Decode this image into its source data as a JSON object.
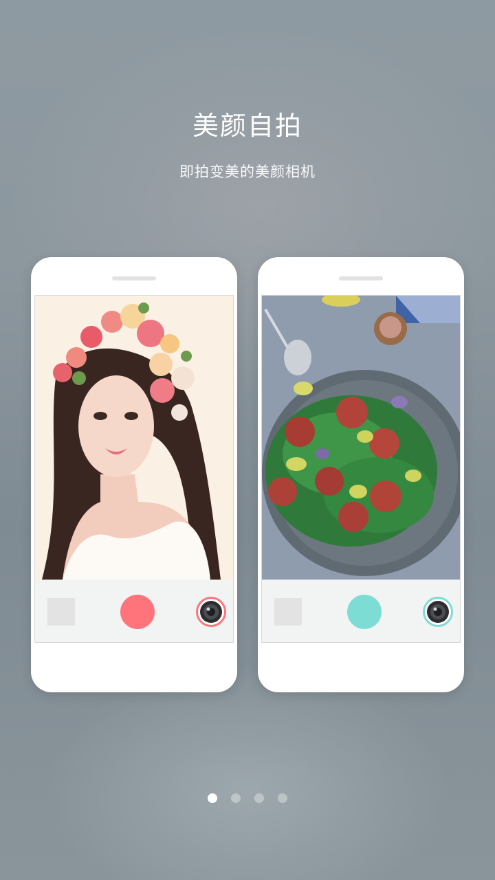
{
  "header": {
    "title": "美颜自拍",
    "subtitle": "即拍变美的美颜相机"
  },
  "phones": [
    {
      "name": "portrait-mode",
      "photo": "portrait-photo",
      "shutter_color": "#ff737b",
      "switch_ring_color": "#ff737b"
    },
    {
      "name": "food-mode",
      "photo": "food-photo",
      "shutter_color": "#7ddcd3",
      "switch_ring_color": "#7ddcd3"
    }
  ],
  "pager": {
    "count": 4,
    "active_index": 0
  },
  "colors": {
    "text": "#ffffff",
    "phone_body": "#ffffff",
    "camera_bar": "#f2f3f3"
  },
  "icons": {
    "camera_switch": "camera-switch-icon",
    "gallery": "gallery-thumbnail-icon"
  }
}
